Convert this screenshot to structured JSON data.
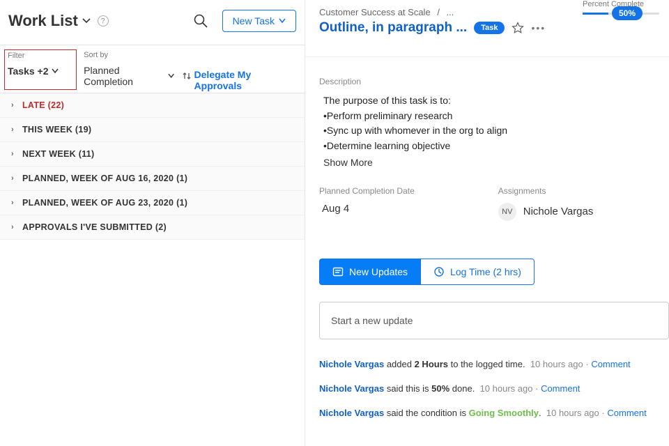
{
  "left": {
    "title": "Work List",
    "help": "?",
    "new_task": "New Task",
    "filter_label": "Filter",
    "filter_value": "Tasks +2",
    "sort_label": "Sort by",
    "sort_value": "Planned Completion",
    "delegate": "Delegate My Approvals",
    "groups": [
      {
        "label": "LATE (22)",
        "late": true
      },
      {
        "label": "THIS WEEK (19)"
      },
      {
        "label": "NEXT WEEK (11)"
      },
      {
        "label": "PLANNED, WEEK OF AUG 16, 2020 (1)"
      },
      {
        "label": "PLANNED, WEEK OF AUG 23, 2020 (1)"
      },
      {
        "label": "APPROVALS I'VE SUBMITTED (2)"
      }
    ]
  },
  "right": {
    "breadcrumb": {
      "project": "Customer Success at Scale",
      "sep": "/",
      "more": "..."
    },
    "title": "Outline, in paragraph ...",
    "pill": "Task",
    "pc_label": "Percent Complete",
    "pc_value": "50%",
    "desc_label": "Description",
    "desc": {
      "intro": "The purpose of this task is to:",
      "b1": "Perform preliminary research",
      "b2": "Sync up with whomever in the org to align",
      "b3": "Determine learning objective",
      "show_more": "Show More"
    },
    "planned_label": "Planned Completion Date",
    "planned_value": "Aug 4",
    "assign_label": "Assignments",
    "assignee_initials": "NV",
    "assignee_name": "Nichole Vargas",
    "tab_updates": "New Updates",
    "tab_log": "Log Time (2 hrs)",
    "update_placeholder": "Start a new update",
    "feed": {
      "u": "Nichole Vargas",
      "r1_a": " added ",
      "r1_b": "2 Hours",
      "r1_c": " to the logged time.",
      "r2_a": " said this is ",
      "r2_b": "50%",
      "r2_c": " done.",
      "r3_a": " said the condition is ",
      "r3_b": "Going Smoothly",
      "r3_c": ".",
      "time": "10 hours ago",
      "comment": "Comment"
    }
  }
}
